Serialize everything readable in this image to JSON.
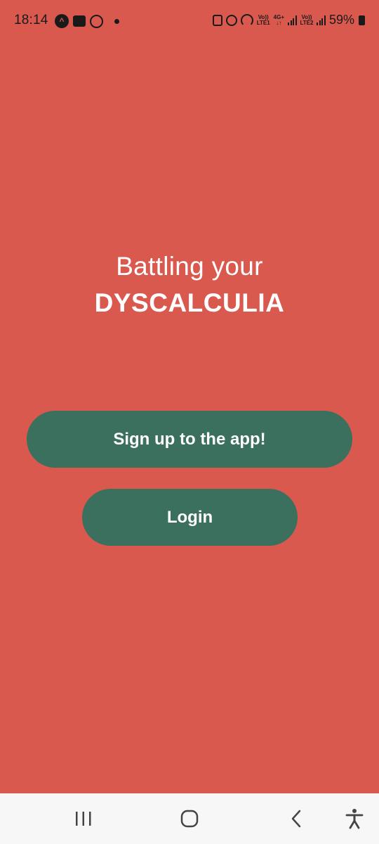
{
  "status_bar": {
    "time": "18:14",
    "sim1_top": "Vo))",
    "sim1_bottom": "LTE1",
    "net_top": "4G+",
    "net_bottom": "↓↑",
    "sim2_top": "Vo))",
    "sim2_bottom": "LTE2",
    "battery": "59%"
  },
  "headline": {
    "line1": "Battling your",
    "line2": "DYSCALCULIA"
  },
  "buttons": {
    "signup_label": "Sign up to the app!",
    "login_label": "Login"
  },
  "colors": {
    "background": "#D9594F",
    "button": "#3A705D",
    "text": "#FFFFFF",
    "nav_bar": "#F7F7F7"
  },
  "icons": {
    "status_left": [
      "app-a-icon",
      "gallery-icon",
      "whatsapp-icon",
      "notification-dot-icon"
    ],
    "status_right": [
      "lock-app-icon",
      "alarm-icon",
      "hotspot-icon",
      "signal-icon",
      "battery-icon"
    ],
    "nav": [
      "recents-icon",
      "home-icon",
      "back-icon",
      "accessibility-icon"
    ]
  }
}
